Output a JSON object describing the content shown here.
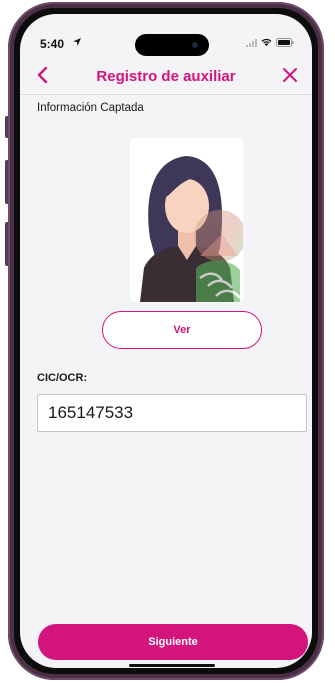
{
  "status_bar": {
    "time": "5:40",
    "location_icon": "location-arrow-icon",
    "signal_icon": "cellular-signal-icon",
    "wifi_icon": "wifi-icon",
    "battery_icon": "battery-icon"
  },
  "header": {
    "title": "Registro de auxiliar",
    "back_icon": "chevron-left-icon",
    "close_icon": "close-icon"
  },
  "section": {
    "label": "Información Captada"
  },
  "photo": {
    "icon": "id-photo-placeholder"
  },
  "buttons": {
    "view_label": "Ver",
    "next_label": "Siguiente"
  },
  "cic_field": {
    "label": "CIC/OCR:",
    "value": "165147533"
  },
  "colors": {
    "accent": "#d4147d",
    "background": "#f4f3f5",
    "phone_frame": "#4a2f47"
  }
}
